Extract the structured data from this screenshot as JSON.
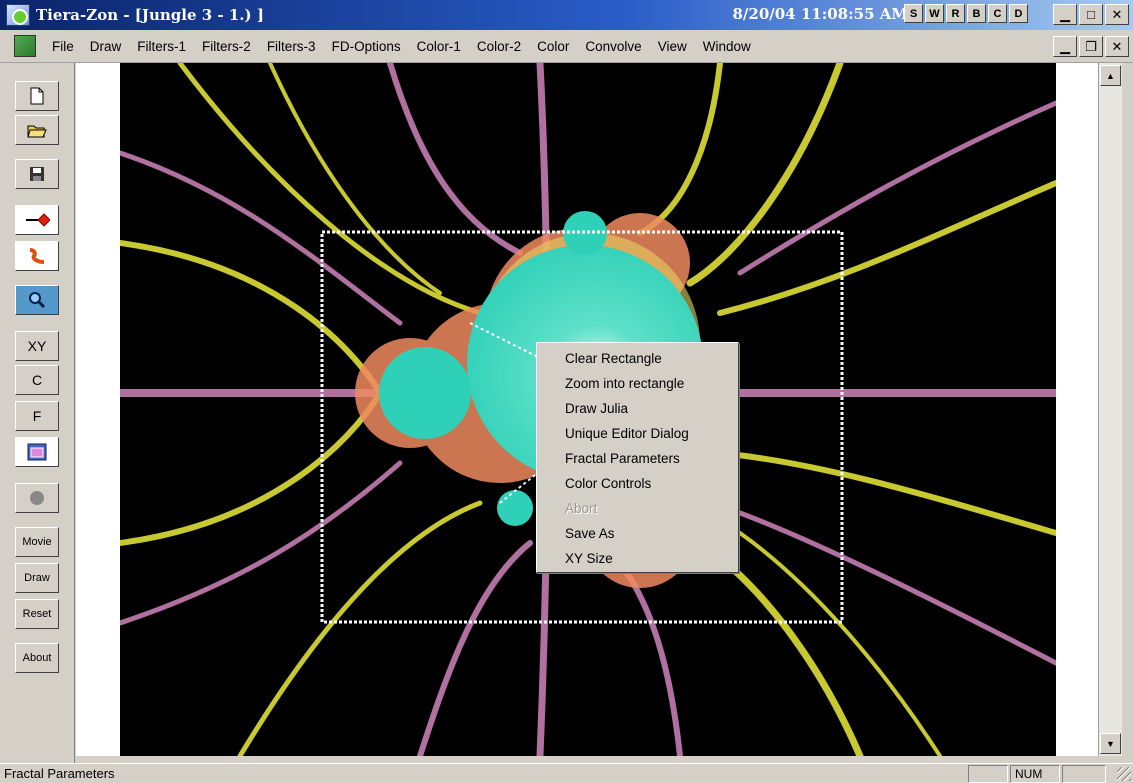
{
  "window": {
    "title": "Tiera-Zon - [Jungle 3 - 1.) ]",
    "clock": "8/20/04 11:08:55 AM",
    "title_buttons": [
      "S",
      "W",
      "R",
      "B",
      "C",
      "D"
    ]
  },
  "menubar": {
    "items": [
      "File",
      "Draw",
      "Filters-1",
      "Filters-2",
      "Filters-3",
      "FD-Options",
      "Color-1",
      "Color-2",
      "Color",
      "Convolve",
      "View",
      "Window"
    ]
  },
  "toolbar": {
    "icons": [
      "new-file-icon",
      "open-folder-icon",
      "save-disk-icon",
      "orbit-point-icon",
      "fractal-brush-icon",
      "zoom-magnifier-icon"
    ],
    "xy_label": "XY",
    "c_label": "C",
    "f_label": "F",
    "movie_label": "Movie",
    "draw_label": "Draw",
    "reset_label": "Reset",
    "about_label": "About"
  },
  "context_menu": {
    "items": [
      {
        "label": "Clear Rectangle",
        "enabled": true
      },
      {
        "label": "Zoom into rectangle",
        "enabled": true
      },
      {
        "label": "Draw Julia",
        "enabled": true
      },
      {
        "label": "Unique Editor Dialog",
        "enabled": true
      },
      {
        "label": "Fractal Parameters",
        "enabled": true
      },
      {
        "label": "Color Controls",
        "enabled": true
      },
      {
        "label": "Abort",
        "enabled": false
      },
      {
        "label": "Save As",
        "enabled": true
      },
      {
        "label": "XY Size",
        "enabled": true
      }
    ]
  },
  "statusbar": {
    "text": "Fractal Parameters",
    "num": "NUM"
  },
  "colors": {
    "titlebar": "#0a246a",
    "fractal_interior": "#3fd8c0",
    "fractal_edge": "#f08a60",
    "filament_yellow": "#c8c830",
    "filament_pink": "#b070a0",
    "background": "#000000"
  }
}
